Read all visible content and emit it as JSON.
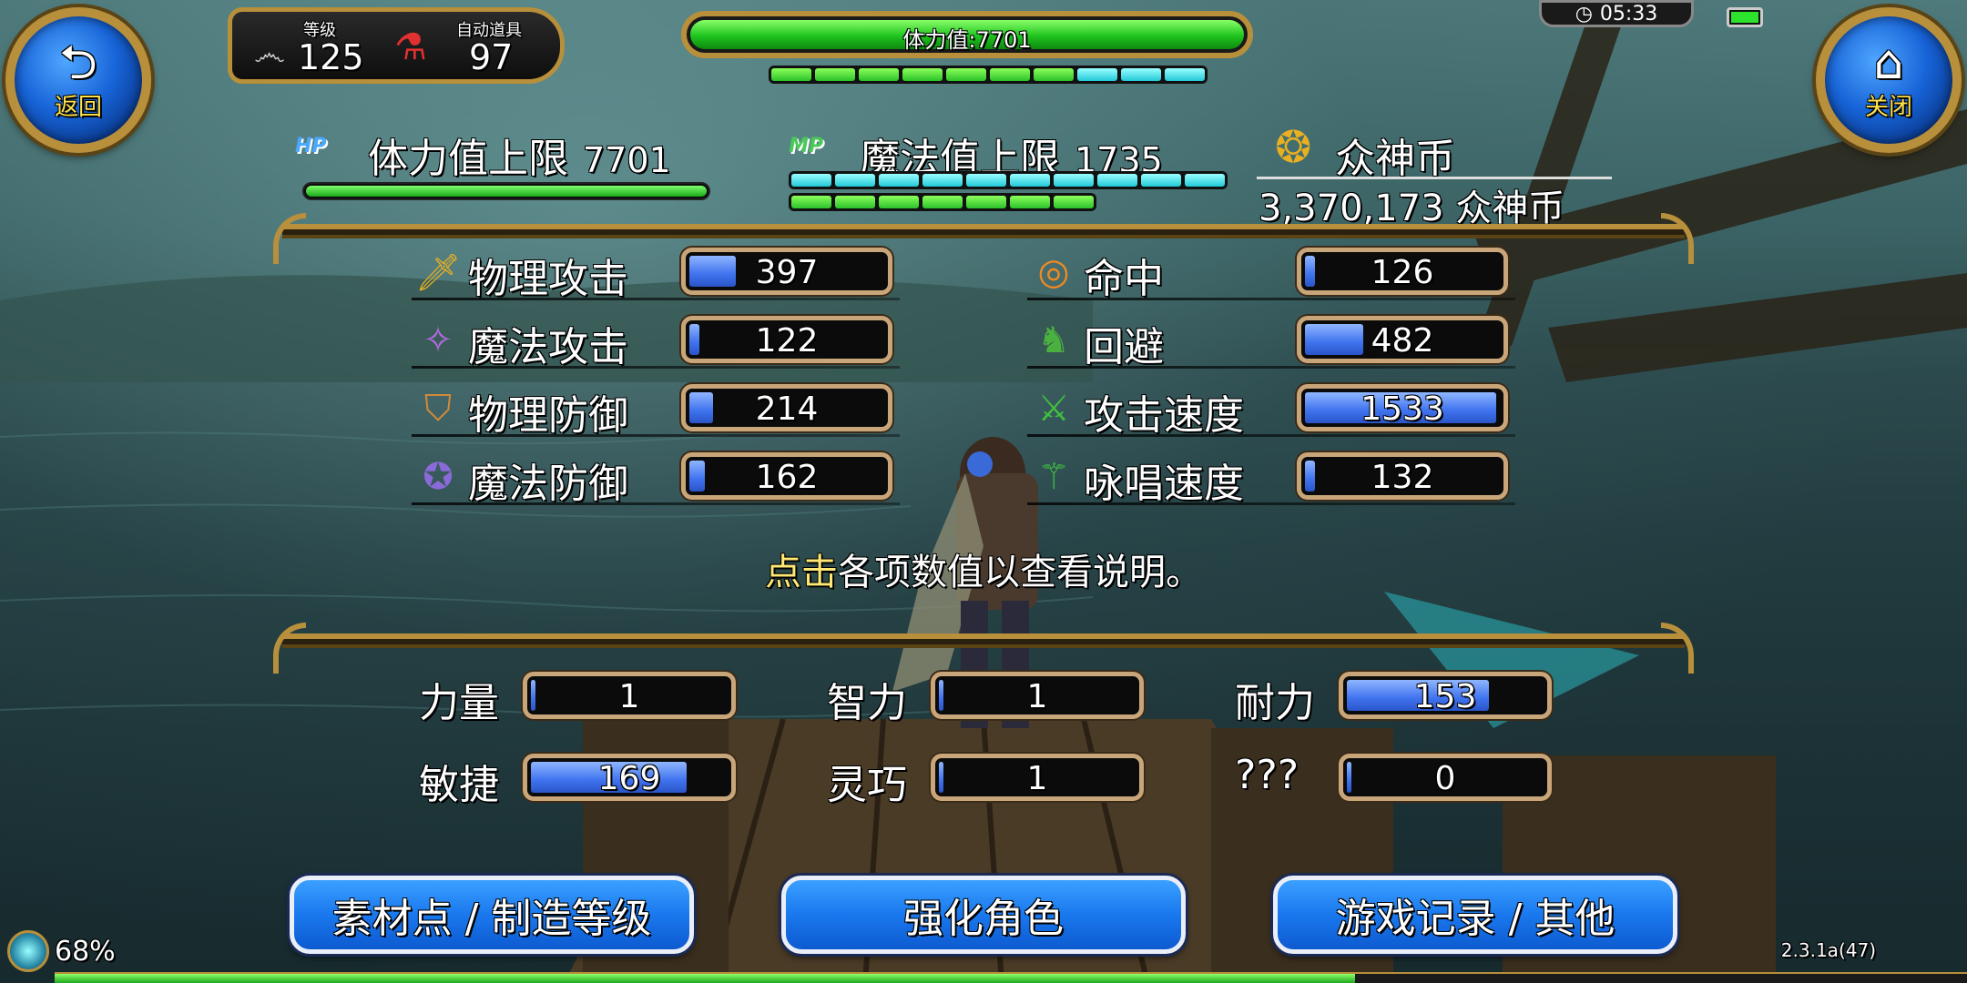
{
  "top": {
    "back_label": "返回",
    "close_label": "关闭",
    "level_label": "等级",
    "level_value": "125",
    "auto_item_label": "自动道具",
    "auto_item_value": "97",
    "hp_bar_label": "体力值:7701",
    "clock": "05:33",
    "battery_level": 1.0
  },
  "header": {
    "hp_badge": "HP",
    "hp_max_label": "体力值上限",
    "hp_max_value": "7701",
    "mp_badge": "MP",
    "mp_max_label": "魔法值上限",
    "mp_max_value": "1735",
    "coin_label": "众神币",
    "coin_amount": "3,370,173 众神币"
  },
  "combat_stats": [
    {
      "label": "物理攻击",
      "value": "397",
      "fill": 0.24,
      "icon": "sword-icon",
      "color": "#e8b020"
    },
    {
      "label": "魔法攻击",
      "value": "122",
      "fill": 0.05,
      "icon": "magic-staff-icon",
      "color": "#b06be0"
    },
    {
      "label": "物理防御",
      "value": "214",
      "fill": 0.12,
      "icon": "shield-icon",
      "color": "#d08a3a"
    },
    {
      "label": "魔法防御",
      "value": "162",
      "fill": 0.08,
      "icon": "star-shield-icon",
      "color": "#8a6ad8"
    },
    {
      "label": "命中",
      "value": "126",
      "fill": 0.05,
      "icon": "target-icon",
      "color": "#f08a20"
    },
    {
      "label": "回避",
      "value": "482",
      "fill": 0.3,
      "icon": "boot-icon",
      "color": "#4ab040"
    },
    {
      "label": "攻击速度",
      "value": "1533",
      "fill": 0.98,
      "icon": "sword-speed-icon",
      "color": "#40c040"
    },
    {
      "label": "咏唱速度",
      "value": "132",
      "fill": 0.05,
      "icon": "staff-speed-icon",
      "color": "#40c040"
    }
  ],
  "hint": {
    "highlight": "点击",
    "rest": "各项数值以查看说明。"
  },
  "base_stats": [
    {
      "label": "力量",
      "value": "1",
      "fill": 0.02
    },
    {
      "label": "智力",
      "value": "1",
      "fill": 0.02
    },
    {
      "label": "耐力",
      "value": "153",
      "fill": 0.72
    },
    {
      "label": "敏捷",
      "value": "169",
      "fill": 0.79
    },
    {
      "label": "灵巧",
      "value": "1",
      "fill": 0.02
    },
    {
      "label": "???",
      "value": "0",
      "fill": 0.02
    }
  ],
  "buttons": {
    "materials": "素材点 / 制造等级",
    "enhance": "强化角色",
    "records": "游戏记录 / 其他"
  },
  "footer": {
    "exp_percent": "68%",
    "exp_fill": 0.68,
    "version": "2.3.1a(47)"
  },
  "colors": {
    "gold": "#b88f3a",
    "highlight_yellow": "#ffe873",
    "stat_fill_blue": "#3f72ee",
    "hp_green": "#1ec41e",
    "mp_cyan": "#22c8d8"
  }
}
